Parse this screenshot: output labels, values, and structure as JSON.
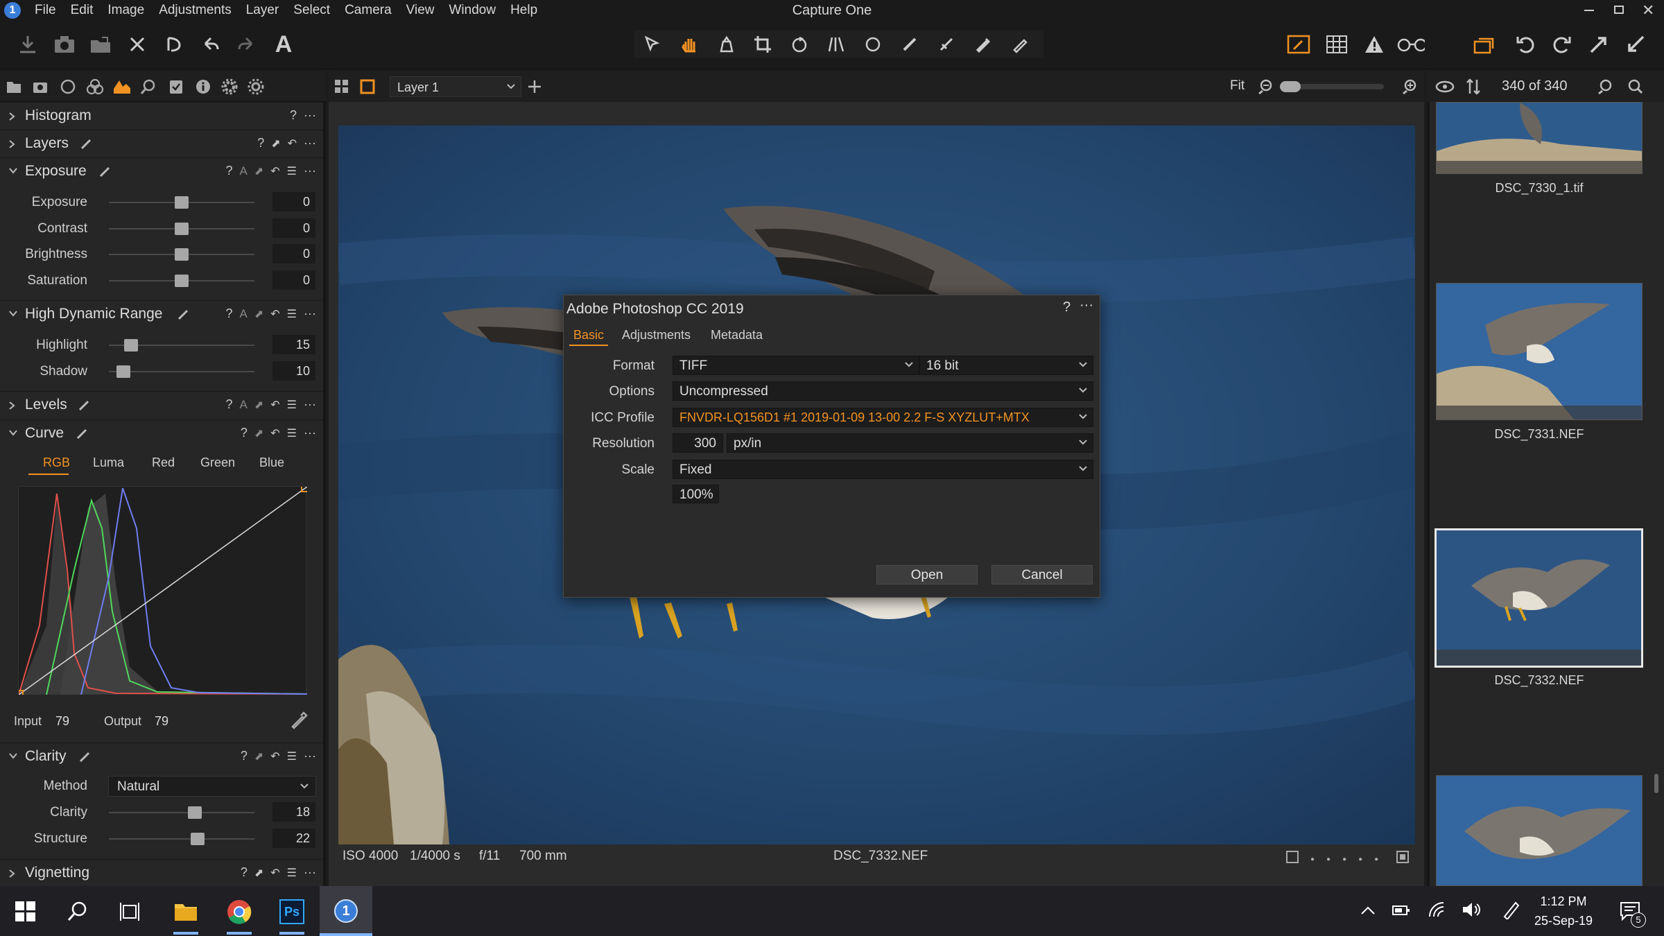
{
  "app": {
    "title": "Capture One",
    "menu": [
      "File",
      "Edit",
      "Image",
      "Adjustments",
      "Layer",
      "Select",
      "Camera",
      "View",
      "Window",
      "Help"
    ]
  },
  "viewer_bar": {
    "layer_select": "Layer 1",
    "zoom_label": "Fit",
    "count": "340 of 340"
  },
  "tools": {
    "histogram": {
      "title": "Histogram"
    },
    "layers": {
      "title": "Layers"
    },
    "exposure": {
      "title": "Exposure",
      "sliders": [
        {
          "label": "Exposure",
          "value": "0",
          "level": 0.5
        },
        {
          "label": "Contrast",
          "value": "0",
          "level": 0.5
        },
        {
          "label": "Brightness",
          "value": "0",
          "level": 0.5
        },
        {
          "label": "Saturation",
          "value": "0",
          "level": 0.5
        }
      ]
    },
    "hdr": {
      "title": "High Dynamic Range",
      "sliders": [
        {
          "label": "Highlight",
          "value": "15",
          "level": 0.15
        },
        {
          "label": "Shadow",
          "value": "10",
          "level": 0.1
        }
      ]
    },
    "levels": {
      "title": "Levels"
    },
    "curve": {
      "title": "Curve",
      "tabs": [
        "RGB",
        "Luma",
        "Red",
        "Green",
        "Blue"
      ],
      "active_tab": "RGB",
      "input_label": "Input",
      "input_value": "79",
      "output_label": "Output",
      "output_value": "79"
    },
    "clarity": {
      "title": "Clarity",
      "method_label": "Method",
      "method_value": "Natural",
      "sliders": [
        {
          "label": "Clarity",
          "value": "18",
          "level": 0.59
        },
        {
          "label": "Structure",
          "value": "22",
          "level": 0.61
        }
      ]
    },
    "vignetting": {
      "title": "Vignetting"
    }
  },
  "dialog": {
    "title": "Adobe Photoshop CC 2019",
    "help": "?",
    "tabs": [
      "Basic",
      "Adjustments",
      "Metadata"
    ],
    "active_tab": "Basic",
    "format_label": "Format",
    "format_value": "TIFF",
    "bit_value": "16 bit",
    "options_label": "Options",
    "options_value": "Uncompressed",
    "icc_label": "ICC Profile",
    "icc_value": "FNVDR-LQ156D1 #1 2019-01-09 13-00 2.2 F-S XYZLUT+MTX",
    "resolution_label": "Resolution",
    "resolution_value": "300",
    "resolution_unit": "px/in",
    "scale_label": "Scale",
    "scale_value": "Fixed",
    "scale_percent": "100%",
    "open_label": "Open",
    "cancel_label": "Cancel"
  },
  "info_bar": {
    "iso": "ISO 4000",
    "shutter": "1/4000 s",
    "aperture": "f/11",
    "focal": "700 mm",
    "filename": "DSC_7332.NEF"
  },
  "thumbnails": [
    "DSC_7330_1.tif",
    "DSC_7331.NEF",
    "DSC_7332.NEF"
  ],
  "taskbar": {
    "time": "1:12 PM",
    "date": "25-Sep-19",
    "notification_count": "5",
    "ps_label": "Ps"
  },
  "colors": {
    "accent": "#f29222",
    "icc_text": "#f29222",
    "panel": "#262626",
    "background": "#1a1a1a"
  }
}
